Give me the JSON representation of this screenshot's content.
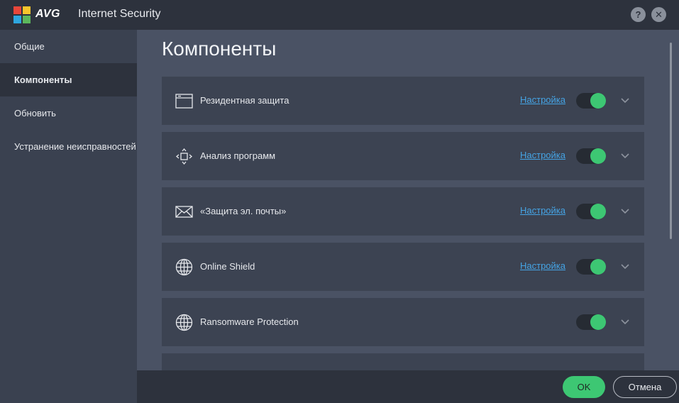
{
  "titlebar": {
    "brand": "AVG",
    "app_title": "Internet Security",
    "help_label": "?",
    "close_label": "✕"
  },
  "sidebar": {
    "items": [
      {
        "label": "Общие",
        "active": false
      },
      {
        "label": "Компоненты",
        "active": true
      },
      {
        "label": "Обновить",
        "active": false
      },
      {
        "label": "Устранение неисправностей",
        "active": false
      }
    ]
  },
  "main": {
    "title": "Компоненты",
    "components": [
      {
        "label": "Резидентная защита",
        "icon": "window-icon",
        "settings_label": "Настройка",
        "enabled": true
      },
      {
        "label": "Анализ программ",
        "icon": "behavior-arrows-icon",
        "settings_label": "Настройка",
        "enabled": true
      },
      {
        "label": "«Защита эл. почты»",
        "icon": "envelope-icon",
        "settings_label": "Настройка",
        "enabled": true
      },
      {
        "label": "Online Shield",
        "icon": "globe-icon",
        "settings_label": "Настройка",
        "enabled": true
      },
      {
        "label": "Ransomware Protection",
        "icon": "globe-icon",
        "settings_label": "",
        "enabled": true
      }
    ]
  },
  "footer": {
    "ok_label": "OK",
    "cancel_label": "Отмена"
  },
  "colors": {
    "accent_green": "#3dc773",
    "link_blue": "#45a4e5",
    "titlebar_bg": "#2d323d",
    "content_bg": "#4a5264",
    "card_bg": "#3c4352"
  }
}
